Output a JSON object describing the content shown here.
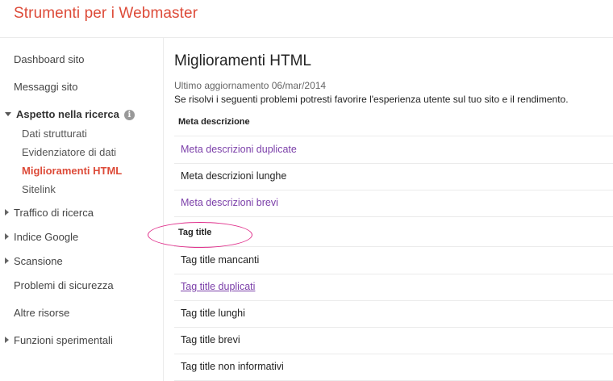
{
  "app": {
    "title": "Strumenti per i Webmaster"
  },
  "sidebar": {
    "dashboard": "Dashboard sito",
    "messages": "Messaggi sito",
    "search_appearance": "Aspetto nella ricerca",
    "info_icon": "i",
    "sub_items": [
      "Dati strutturati",
      "Evidenziatore di dati",
      "Miglioramenti HTML",
      "Sitelink"
    ],
    "search_traffic": "Traffico di ricerca",
    "google_index": "Indice Google",
    "crawl": "Scansione",
    "security": "Problemi di sicurezza",
    "other_resources": "Altre risorse",
    "labs": "Funzioni sperimentali"
  },
  "main": {
    "title": "Miglioramenti HTML",
    "updated": "Ultimo aggiornamento 06/mar/2014",
    "description": "Se risolvi i seguenti problemi potresti favorire l'esperienza utente sul tuo sito e il rendimento.",
    "meta_section": {
      "header": "Meta descrizione",
      "rows": [
        "Meta descrizioni duplicate",
        "Meta descrizioni lunghe",
        "Meta descrizioni brevi"
      ]
    },
    "title_section": {
      "header": "Tag title",
      "rows": [
        "Tag title mancanti",
        "Tag title duplicati",
        "Tag title lunghi",
        "Tag title brevi",
        "Tag title non informativi"
      ]
    }
  },
  "colors": {
    "brand": "#dd4b39",
    "visited_link": "#7b3fa9",
    "annotation": "#e0318c"
  }
}
